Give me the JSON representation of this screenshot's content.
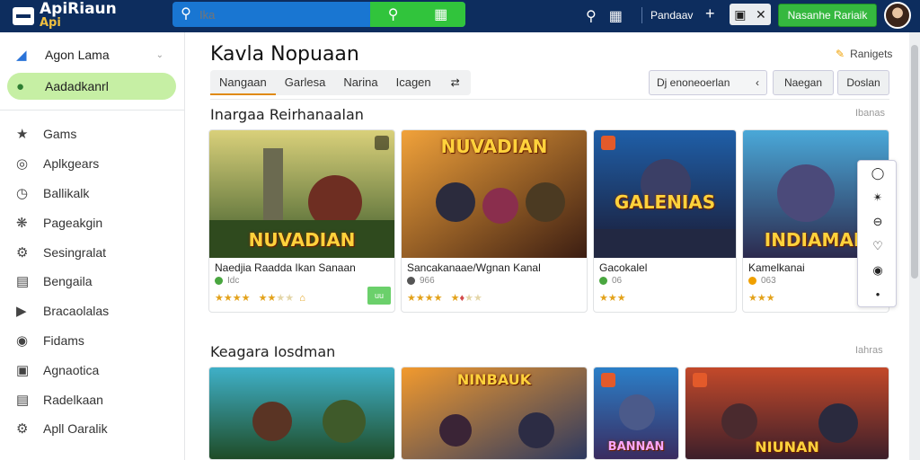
{
  "colors": {
    "topbar": "#0d2d5e",
    "search_bg": "#1976d2",
    "accent_green": "#35b83f",
    "active_nav": "#c6efa4",
    "star": "#e3a21a"
  },
  "header": {
    "logo_line1": "ApiRiaun",
    "logo_line2": "Api",
    "search_placeholder": "Ika",
    "nav_label": "Pandaav",
    "cta_label": "Nasanhe Rariaik"
  },
  "sidebar": {
    "top_items": [
      {
        "label": "Agon Lama",
        "icon": "puzzle-icon"
      },
      {
        "label": "Aadadkanrl",
        "icon": "home-icon",
        "active": true
      }
    ],
    "items": [
      {
        "label": "Gams",
        "icon": "gamepad-icon"
      },
      {
        "label": "Aplkgears",
        "icon": "app-icon"
      },
      {
        "label": "Ballikalk",
        "icon": "clock-icon"
      },
      {
        "label": "Pageakgin",
        "icon": "settings-icon"
      },
      {
        "label": "Sesingralat",
        "icon": "gear-icon"
      },
      {
        "label": "Bengaila",
        "icon": "grid-icon"
      },
      {
        "label": "Bracaolalas",
        "icon": "arrow-icon"
      },
      {
        "label": "Fidams",
        "icon": "pin-icon"
      },
      {
        "label": "Agnaotica",
        "icon": "monitor-icon"
      },
      {
        "label": "Radelkaan",
        "icon": "document-icon"
      },
      {
        "label": "Apll Oaralik",
        "icon": "cog-icon"
      }
    ]
  },
  "main": {
    "title": "Kavla Nopuaan",
    "top_right_link": "Ranigets",
    "tabs": [
      "Nangaan",
      "Garlesa",
      "Narina",
      "Icagen"
    ],
    "filter_select": "Dj enoneoerlan",
    "filter_btn_1": "Naegan",
    "filter_btn_2": "Doslan",
    "section1": {
      "title": "Inargaa Reirhanaalan",
      "more": "Ibanas",
      "cards": [
        {
          "title": "Naedjia Raadda Ikan Sanaan",
          "meta": "Idc",
          "dot": "#49a63f",
          "rating": 4.5,
          "banner": "NUVADIAN",
          "has_install": true,
          "install_label": "uu"
        },
        {
          "title": "Sancakanaae/Wgnan Kanal",
          "meta": "966",
          "dot": "#555",
          "rating": 3.5,
          "banner": "NUVADIAN",
          "has_install": false
        },
        {
          "title": "Gacokalel",
          "meta": "06",
          "dot": "#49a63f",
          "rating": 3,
          "banner": "GALENIAS",
          "has_install": false
        },
        {
          "title": "Kamelkanai",
          "meta": "063",
          "dot": "#f0a000",
          "rating": 3.5,
          "banner": "INDIAMAR",
          "has_install": false
        }
      ]
    },
    "section2": {
      "title": "Keagara Iosdman",
      "more": "Iahras",
      "cards": [
        {
          "banner": "",
          "tone": "forest"
        },
        {
          "banner": "NINBAUK",
          "tone": "fire"
        },
        {
          "banner": "BANNAN",
          "tone": "blue"
        },
        {
          "banner": "NIUNAN",
          "tone": "dusk"
        }
      ]
    }
  },
  "floating_panel": {
    "buttons": [
      "shield-icon",
      "share-icon",
      "minus-icon",
      "heart-icon",
      "circle-icon",
      "dot-icon"
    ]
  }
}
